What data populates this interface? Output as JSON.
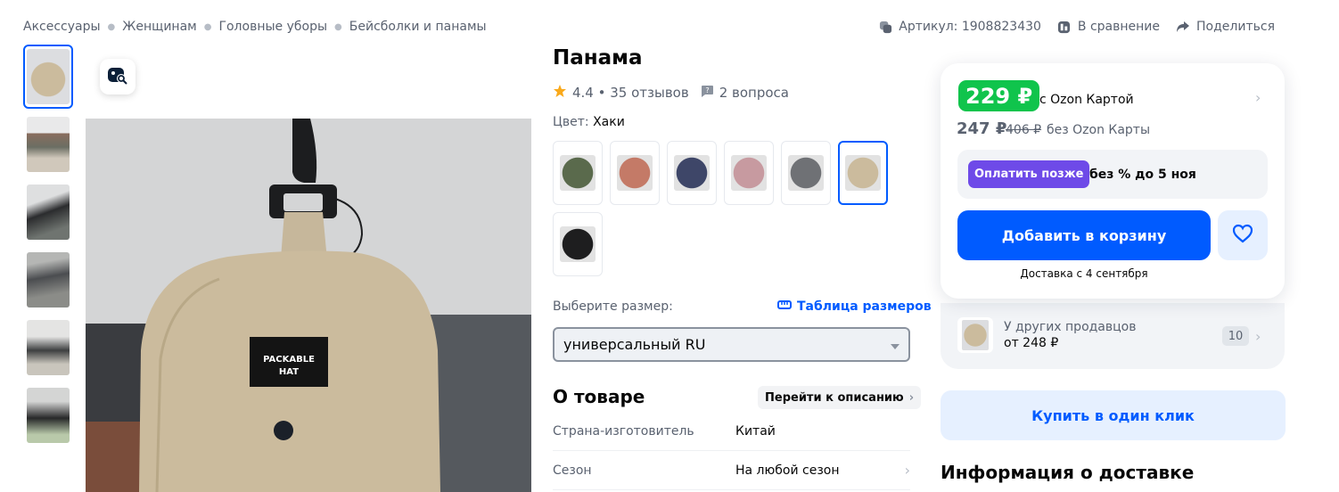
{
  "breadcrumbs": [
    "Аксессуары",
    "Женщинам",
    "Головные уборы",
    "Бейсболки и панамы"
  ],
  "top_actions": {
    "article": "Артикул: 1908823430",
    "compare": "В сравнение",
    "share": "Поделиться"
  },
  "product": {
    "title": "Панама",
    "rating": "4.4 • 35 отзывов",
    "questions": "2 вопроса",
    "color_label": "Цвет: ",
    "color_value": "Хаки",
    "hat_label_line1": "PACKABLE",
    "hat_label_line2": "HAT",
    "color_swatches": [
      "#5a6a4c",
      "#c47a67",
      "#3e4668",
      "#c79aa0",
      "#6f7175",
      "#cbbb9d",
      "#1e1e1f"
    ],
    "size_label": "Выберите размер:",
    "size_table": "Таблица размеров",
    "size_value": "универсальный RU"
  },
  "about": {
    "title": "О товаре",
    "go_description": "Перейти к описанию",
    "props": [
      {
        "k": "Страна-изготовитель",
        "v": "Китай"
      },
      {
        "k": "Сезон",
        "v": "На любой сезон"
      }
    ]
  },
  "buy": {
    "price": "229 ₽",
    "with_card": "с Ozon Картой",
    "price_no_card": "247 ₽",
    "old_price": "406 ₽",
    "no_card": "без Ozon Карты",
    "pay_later_btn": "Оплатить позже",
    "pay_later_text": "без % до 5 ноя",
    "add_to_cart": "Добавить в корзину",
    "delivery": "Доставка с 4 сентября",
    "other_sellers": "У других продавцов",
    "other_from": "от 248 ₽",
    "other_count": "10",
    "one_click": "Купить в один клик",
    "delivery_info": "Информация о доставке"
  },
  "colors": {
    "accent": "#005bff",
    "price_green": "#10c44c",
    "pay_later": "#6e4ae8",
    "rating_star": "#f9a91b"
  }
}
